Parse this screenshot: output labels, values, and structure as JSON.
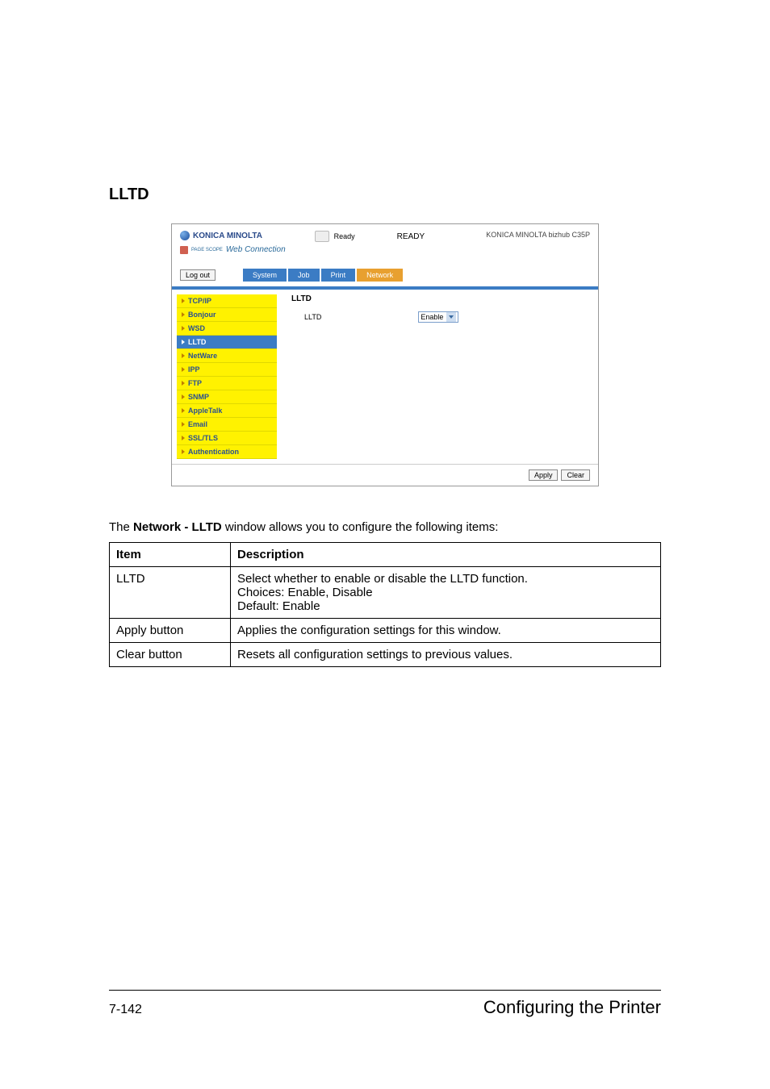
{
  "page": {
    "section_title": "LLTD",
    "lead_before": "The ",
    "lead_bold": "Network - LLTD",
    "lead_after": " window allows you to configure the following items:",
    "page_number": "7-142",
    "footer_title": "Configuring the Printer"
  },
  "screenshot": {
    "brand": "KONICA MINOLTA",
    "pagescope_prefix": "PAGE SCOPE",
    "pagescope": "Web Connection",
    "status_small": "Ready",
    "status_big": "READY",
    "model": "KONICA MINOLTA bizhub C35P",
    "logout": "Log out",
    "tabs": [
      "System",
      "Job",
      "Print",
      "Network"
    ],
    "sidebar": [
      "TCP/IP",
      "Bonjour",
      "WSD",
      "LLTD",
      "NetWare",
      "IPP",
      "FTP",
      "SNMP",
      "AppleTalk",
      "Email",
      "SSL/TLS",
      "Authentication"
    ],
    "active_sidebar_index": 3,
    "content_title": "LLTD",
    "row_label": "LLTD",
    "select_value": "Enable",
    "apply": "Apply",
    "clear": "Clear"
  },
  "table": {
    "head_item": "Item",
    "head_desc": "Description",
    "rows": [
      {
        "item": "LLTD",
        "desc": "Select whether to enable or disable the LLTD function.\nChoices: Enable, Disable\nDefault:  Enable"
      },
      {
        "item": "Apply button",
        "desc": "Applies the configuration settings for this window."
      },
      {
        "item": "Clear button",
        "desc": "Resets all configuration settings to previous values."
      }
    ]
  }
}
